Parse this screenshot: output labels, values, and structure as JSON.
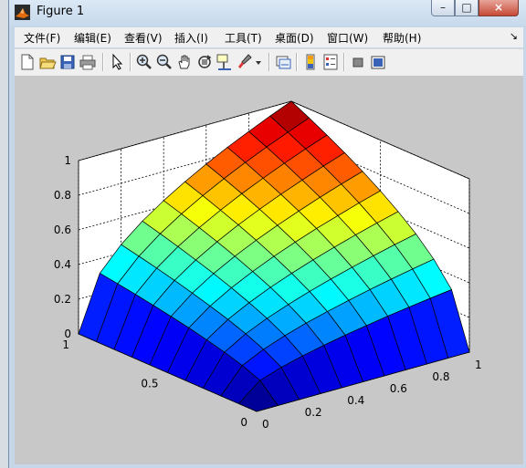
{
  "window": {
    "title": "Figure 1",
    "controls": {
      "minimize": "–",
      "maximize": "□",
      "close": "×"
    }
  },
  "menu": {
    "items": [
      "文件(F)",
      "编辑(E)",
      "查看(V)",
      "插入(I)",
      "工具(T)",
      "桌面(D)",
      "窗口(W)",
      "帮助(H)"
    ],
    "dock_glyph": "↘"
  },
  "toolbar": {
    "buttons": [
      "new-figure",
      "open-file",
      "save-figure",
      "print-figure",
      "edit-plot",
      "zoom-in",
      "zoom-out",
      "pan",
      "rotate-3d",
      "data-cursor",
      "brush",
      "brush-dropdown",
      "link-plot",
      "insert-colorbar",
      "insert-legend",
      "hide-plot-tools",
      "show-plot-tools"
    ]
  },
  "chart_data": {
    "type": "surface",
    "description_free": true,
    "x_ticks": [
      "0",
      "0.2",
      "0.4",
      "0.6",
      "0.8",
      "1"
    ],
    "y_ticks": [
      "0",
      "0.5",
      "1"
    ],
    "z_ticks": [
      "0",
      "0.2",
      "0.4",
      "0.6",
      "0.8",
      "1"
    ],
    "xlim": [
      0,
      1
    ],
    "ylim": [
      0,
      1
    ],
    "zlim": [
      0,
      1
    ],
    "grid": true,
    "colormap": "jet",
    "x": [
      0,
      0.1,
      0.2,
      0.3,
      0.4,
      0.5,
      0.6,
      0.7,
      0.8,
      0.9,
      1.0
    ],
    "y": [
      0,
      0.1,
      0.2,
      0.3,
      0.4,
      0.5,
      0.6,
      0.7,
      0.8,
      0.9,
      1.0
    ],
    "z_formula_values": "z = sqrt(x*y)",
    "z": [
      [
        0,
        0,
        0,
        0,
        0,
        0,
        0,
        0,
        0,
        0,
        0
      ],
      [
        0,
        0.1,
        0.141,
        0.173,
        0.2,
        0.224,
        0.245,
        0.265,
        0.283,
        0.3,
        0.316
      ],
      [
        0,
        0.141,
        0.2,
        0.245,
        0.283,
        0.316,
        0.346,
        0.374,
        0.4,
        0.424,
        0.447
      ],
      [
        0,
        0.173,
        0.245,
        0.3,
        0.346,
        0.387,
        0.424,
        0.458,
        0.49,
        0.52,
        0.548
      ],
      [
        0,
        0.2,
        0.283,
        0.346,
        0.4,
        0.447,
        0.49,
        0.529,
        0.566,
        0.6,
        0.632
      ],
      [
        0,
        0.224,
        0.316,
        0.387,
        0.447,
        0.5,
        0.548,
        0.592,
        0.632,
        0.671,
        0.707
      ],
      [
        0,
        0.245,
        0.346,
        0.424,
        0.49,
        0.548,
        0.6,
        0.648,
        0.693,
        0.735,
        0.775
      ],
      [
        0,
        0.265,
        0.374,
        0.458,
        0.529,
        0.592,
        0.648,
        0.7,
        0.748,
        0.794,
        0.837
      ],
      [
        0,
        0.283,
        0.4,
        0.49,
        0.566,
        0.632,
        0.693,
        0.748,
        0.8,
        0.849,
        0.894
      ],
      [
        0,
        0.3,
        0.424,
        0.52,
        0.6,
        0.671,
        0.735,
        0.794,
        0.849,
        0.9,
        0.949
      ],
      [
        0,
        0.316,
        0.447,
        0.548,
        0.632,
        0.707,
        0.775,
        0.837,
        0.894,
        0.949,
        1.0
      ]
    ]
  }
}
